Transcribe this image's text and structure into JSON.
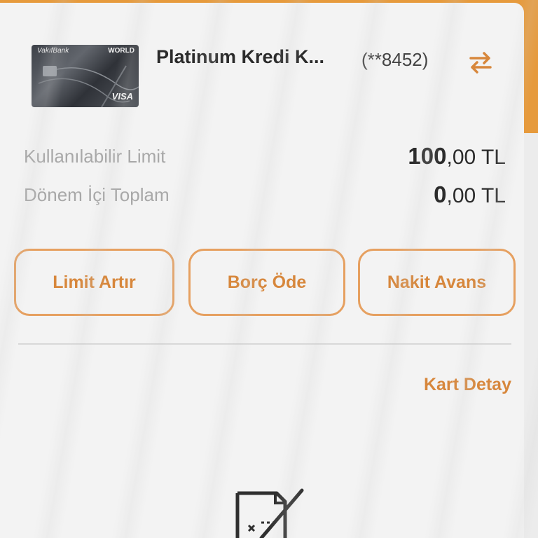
{
  "card": {
    "bank": "VakıfBank",
    "tier": "WORLD",
    "network": "VISA",
    "title": "Platinum Kredi K...",
    "masked_number": "(**8452)"
  },
  "icons": {
    "swap": "swap-arrows-icon",
    "document": "document-disabled-icon"
  },
  "summary": {
    "available_limit_label": "Kullanılabilir Limit",
    "available_limit_main": "100",
    "available_limit_rest": ",00 TL",
    "period_total_label": "Dönem İçi Toplam",
    "period_total_main": "0",
    "period_total_rest": ",00 TL"
  },
  "actions": {
    "limit_increase": "Limit Artır",
    "pay_debt": "Borç Öde",
    "cash_advance": "Nakit Avans"
  },
  "links": {
    "card_detail": "Kart Detay"
  },
  "colors": {
    "accent": "#d7873c",
    "border": "#e6a060",
    "background": "#f3f3f3",
    "frame": "#e69a3c"
  }
}
